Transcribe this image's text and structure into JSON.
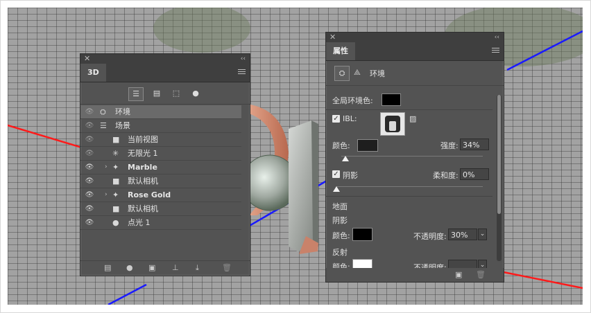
{
  "panel_3d": {
    "tab": "3D",
    "rows": [
      {
        "label": "环境",
        "icon": "environment-icon",
        "glyph": "⛭",
        "indent": 1,
        "selected": true,
        "expand": false
      },
      {
        "label": "场景",
        "icon": "scene-icon",
        "glyph": "☰",
        "indent": 1,
        "selected": false,
        "expand": false
      },
      {
        "label": "当前视图",
        "icon": "camera-icon",
        "glyph": "■",
        "indent": 2,
        "selected": false,
        "expand": false
      },
      {
        "label": "无限光 1",
        "icon": "infinite-light-icon",
        "glyph": "✳",
        "indent": 2,
        "selected": false,
        "expand": false
      },
      {
        "label": "Marble",
        "icon": "mesh-icon",
        "glyph": "✦",
        "indent": 2,
        "selected": false,
        "expand": true
      },
      {
        "label": "默认相机",
        "icon": "camera-icon",
        "glyph": "■",
        "indent": 2,
        "selected": false,
        "expand": false
      },
      {
        "label": "Rose Gold",
        "icon": "mesh-icon",
        "glyph": "✦",
        "indent": 2,
        "selected": false,
        "expand": true
      },
      {
        "label": "默认相机",
        "icon": "camera-icon",
        "glyph": "■",
        "indent": 2,
        "selected": false,
        "expand": false
      },
      {
        "label": "点光 1",
        "icon": "point-light-icon",
        "glyph": "●",
        "indent": 2,
        "selected": false,
        "expand": false
      }
    ]
  },
  "properties": {
    "tab": "属性",
    "header_label": "环境",
    "global_ambient_label": "全局环境色:",
    "global_ambient_color": "#000000",
    "ibl_label": "IBL:",
    "ibl_checked": true,
    "color_label": "颜色:",
    "color_value": "#1e1e1e",
    "intensity_label": "强度:",
    "intensity_value": "34%",
    "intensity_level": 0.03,
    "shadow_label": "阴影",
    "shadow_checked": true,
    "softness_label": "柔和度:",
    "softness_value": "0%",
    "softness_level": 0.0,
    "ground_label": "地面",
    "ground_shadow_label": "阴影",
    "ground_shadow_color_label": "颜色:",
    "ground_shadow_color": "#000000",
    "opacity_label": "不透明度:",
    "opacity_value": "30%",
    "reflection_label": "反射",
    "reflection_color_label": "颜色:",
    "reflection_color": "#ffffff",
    "reflection_opacity_label": "不透明度:",
    "reflection_opacity_value": ""
  },
  "colors": {
    "panel_bg": "#535353",
    "axis_red": "#ff1a1a",
    "axis_blue": "#1a1aff",
    "rose_gold": "#c9826a",
    "marble": "#b8bcb8"
  }
}
